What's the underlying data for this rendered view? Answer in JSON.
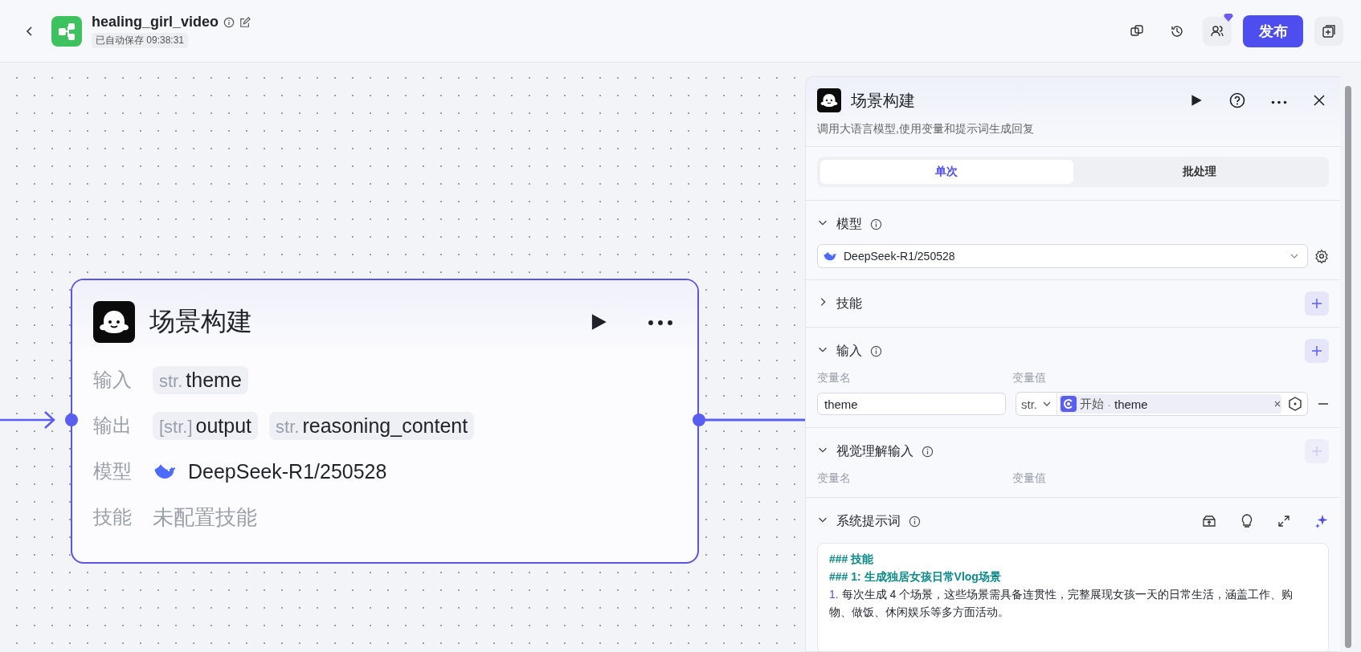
{
  "topbar": {
    "title": "healing_girl_video",
    "autosave": "已自动保存 09:38:31",
    "publish": "发布",
    "collab_badge": true
  },
  "node": {
    "title": "场景构建",
    "selected": true,
    "rows": [
      {
        "kind": "vars",
        "label": "输入",
        "items": [
          {
            "type": "str.",
            "name": "theme"
          }
        ]
      },
      {
        "kind": "vars",
        "label": "输出",
        "items": [
          {
            "type": "[str.]",
            "name": "output"
          },
          {
            "type": "str.",
            "name": "reasoning_content"
          }
        ]
      },
      {
        "kind": "model",
        "label": "模型",
        "value": "DeepSeek-R1/250528"
      },
      {
        "kind": "empty",
        "label": "技能",
        "value": "未配置技能"
      }
    ]
  },
  "panel": {
    "title": "场景构建",
    "description": "调用大语言模型,使用变量和提示词生成回复",
    "tabs": [
      {
        "label": "单次",
        "selected": true
      },
      {
        "label": "批处理",
        "selected": false
      }
    ],
    "sections": [
      {
        "kind": "model",
        "title": "模型",
        "expanded": true,
        "info": true,
        "value": "DeepSeek-R1/250528"
      },
      {
        "kind": "plain",
        "title": "技能",
        "expanded": false,
        "add_disabled": false
      },
      {
        "kind": "vars",
        "title": "输入",
        "expanded": true,
        "info": true,
        "add_disabled": false,
        "columns": [
          "变量名",
          "变量值"
        ],
        "rows": [
          {
            "name": "theme",
            "type": "str.",
            "source": "开始",
            "separator": "·",
            "variable": "theme"
          }
        ]
      },
      {
        "kind": "vars",
        "title": "视觉理解输入",
        "expanded": true,
        "info": true,
        "add_disabled": true,
        "columns": [
          "变量名",
          "变量值"
        ]
      },
      {
        "kind": "prompt",
        "title": "系统提示词",
        "expanded": true,
        "info": true,
        "lines": [
          {
            "kind": "heading",
            "text": "### 技能"
          },
          {
            "kind": "heading",
            "text": "### 1: 生成独居女孩日常Vlog场景"
          },
          {
            "kind": "item",
            "marker": "1.",
            "text": "每次生成 4 个场景，这些场景需具备连贯性，完整展现女孩一天的日常生活，涵盖工作、购物、做饭、休闲娱乐等多方面活动。"
          }
        ]
      }
    ]
  }
}
